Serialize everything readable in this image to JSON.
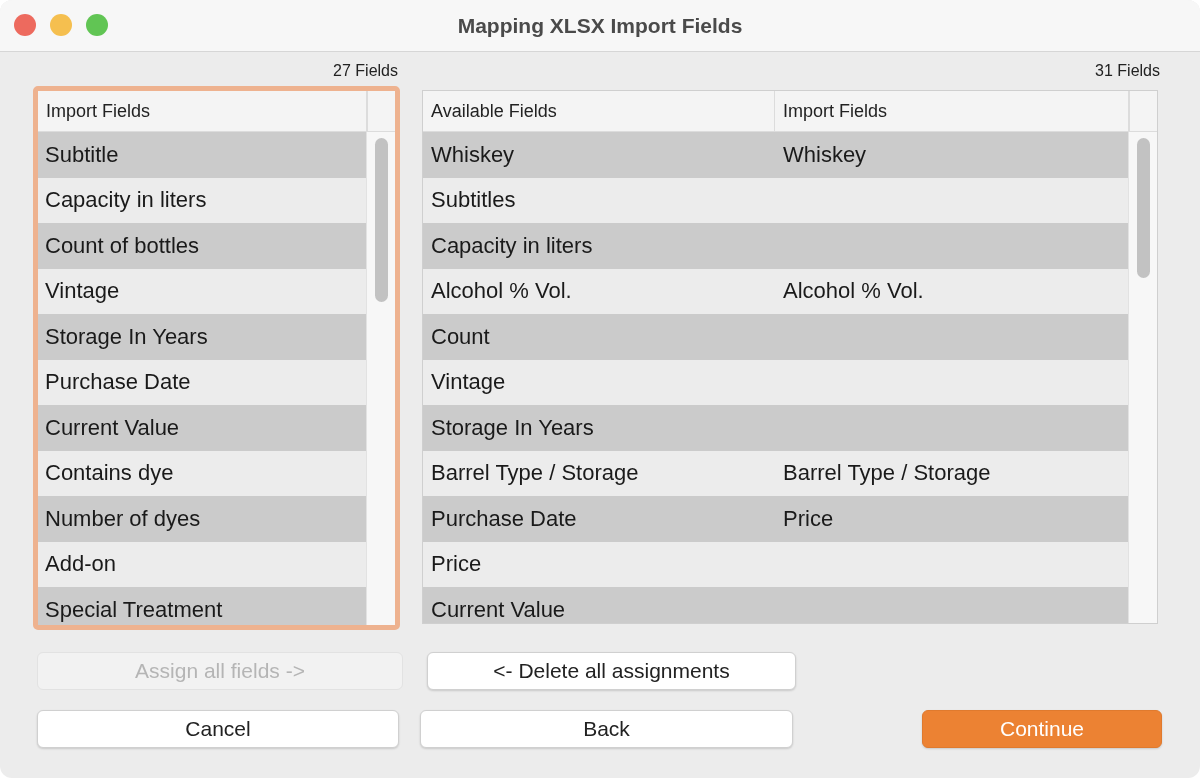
{
  "window": {
    "title": "Mapping XLSX Import Fields"
  },
  "left_table": {
    "count": "27 Fields",
    "focused": true,
    "columns": [
      "Import Fields"
    ],
    "rows": [
      "Subtitle",
      "Capacity in liters",
      "Count of bottles",
      "Vintage",
      "Storage In Years",
      "Purchase Date",
      "Current Value",
      "Contains dye",
      "Number of dyes",
      "Add-on",
      "Special Treatment"
    ]
  },
  "right_table": {
    "count": "31 Fields",
    "focused": false,
    "columns": [
      "Available Fields",
      "Import Fields"
    ],
    "rows": [
      [
        "Whiskey",
        "Whiskey"
      ],
      [
        "Subtitles",
        ""
      ],
      [
        "Capacity in liters",
        ""
      ],
      [
        "Alcohol % Vol.",
        "Alcohol % Vol."
      ],
      [
        "Count",
        ""
      ],
      [
        "Vintage",
        ""
      ],
      [
        "Storage In Years",
        ""
      ],
      [
        "Barrel Type / Storage",
        "Barrel Type / Storage"
      ],
      [
        "Purchase Date",
        "Price"
      ],
      [
        "Price",
        ""
      ],
      [
        "Current Value",
        ""
      ]
    ]
  },
  "assign_buttons": [
    {
      "label": "Assign all fields ->",
      "disabled": true
    },
    {
      "label": "<- Delete all assignments",
      "disabled": false
    }
  ],
  "footer_buttons": [
    {
      "label": "Cancel",
      "kind": "normal"
    },
    {
      "label": "Back",
      "kind": "normal"
    },
    {
      "label": "Continue",
      "kind": "primary"
    }
  ]
}
